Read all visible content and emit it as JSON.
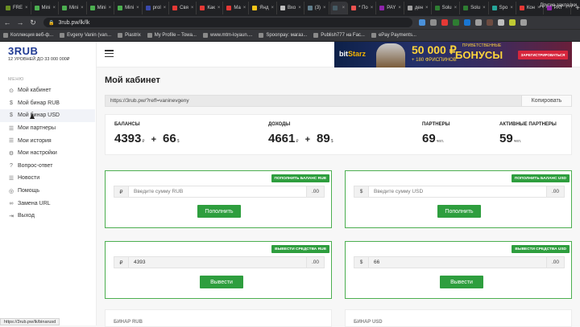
{
  "browser": {
    "tabs": [
      {
        "label": "FRE",
        "color": "#6b8e23"
      },
      {
        "label": "Mini",
        "color": "#4caf50"
      },
      {
        "label": "Mini",
        "color": "#4caf50"
      },
      {
        "label": "Mini",
        "color": "#4caf50"
      },
      {
        "label": "Mini",
        "color": "#4caf50"
      },
      {
        "label": "prol",
        "color": "#3949ab"
      },
      {
        "label": "Свя",
        "color": "#e53935"
      },
      {
        "label": "Как",
        "color": "#e53935"
      },
      {
        "label": "Ма",
        "color": "#e53935"
      },
      {
        "label": "Янд",
        "color": "#f5c518"
      },
      {
        "label": "Вхо",
        "color": "#bdbdbd"
      },
      {
        "label": "(3)",
        "color": "#607d8b"
      },
      {
        "label": "",
        "color": "#455a64"
      },
      {
        "label": "* По",
        "color": "#ef5350"
      },
      {
        "label": "PAY",
        "color": "#8e24aa"
      },
      {
        "label": "ден",
        "color": "#9e9e9e"
      },
      {
        "label": "Solu",
        "color": "#2e7d32"
      },
      {
        "label": "Solu",
        "color": "#2e7d32"
      },
      {
        "label": "Spo",
        "color": "#26a69a"
      },
      {
        "label": "Кон",
        "color": "#e53935"
      },
      {
        "label": "PAY",
        "color": "#8e24aa"
      }
    ],
    "url": "3rub.pw/lk/lk",
    "bookmarks": [
      "Коллекция веб-ф...",
      "Evgeny Vanin (van...",
      "Piastrix",
      "My Profile – Towa...",
      "www.mtm-loyaun....",
      "Spoonpay: магаз...",
      "Publish777 на Fac...",
      "ePay Payments..."
    ],
    "other_bookmarks": "Другие закладки",
    "status_url": "https://3rub.pw/lk/binarusd"
  },
  "sidebar": {
    "logo": "3RUB",
    "tagline": "12 УРОВНЕЙ ДО 33 000 000₽",
    "menu_heading": "МЕНЮ",
    "items": [
      {
        "label": "Мой кабинет",
        "icon": "user-icon",
        "glyph": "⊙"
      },
      {
        "label": "Мой бинар RUB",
        "icon": "dollar-icon",
        "glyph": "$"
      },
      {
        "label": "Мой бинар USD",
        "icon": "dollar-icon",
        "glyph": "$"
      },
      {
        "label": "Мои партнеры",
        "icon": "users-icon",
        "glyph": "☰"
      },
      {
        "label": "Мои история",
        "icon": "list-icon",
        "glyph": "☰"
      },
      {
        "label": "Мои настройки",
        "icon": "gear-icon",
        "glyph": "⚙"
      },
      {
        "label": "Вопрос-ответ",
        "icon": "question-icon",
        "glyph": "?"
      },
      {
        "label": "Новости",
        "icon": "news-icon",
        "glyph": "☰"
      },
      {
        "label": "Помощь",
        "icon": "help-icon",
        "glyph": "◎"
      },
      {
        "label": "Замена URL",
        "icon": "link-icon",
        "glyph": "∞"
      },
      {
        "label": "Выход",
        "icon": "logout-icon",
        "glyph": "⇥"
      }
    ]
  },
  "banner": {
    "brand": "bit",
    "brand_accent": "Starz",
    "amount": "50 000 ₽",
    "free_spins": "+ 180 ФРИСПИНОВ",
    "title_small": "ПРИВЕТСТВЕННЫЕ",
    "title_big": "БОНУСЫ",
    "button": "ЗАРЕГИСТРИРОВАТЬСЯ"
  },
  "page": {
    "title": "Мой кабинет",
    "ref_url": "https://3rub.pw/?reff=vaninevgeny",
    "copy_label": "Копировать"
  },
  "stats": {
    "balance_label": "БАЛАНСЫ",
    "balance_rub": "4393",
    "rub_sign": "₽",
    "plus": "+",
    "balance_usd": "66",
    "usd_sign": "$",
    "income_label": "ДОХОДЫ",
    "income_rub": "4661",
    "income_usd": "89",
    "partners_label": "ПАРТНЕРЫ",
    "partners_value": "69",
    "partners_unit": "чел.",
    "active_label": "АКТИВНЫЕ ПАРТНЕРЫ",
    "active_value": "59",
    "active_unit": "чел."
  },
  "cards": {
    "topup_rub": {
      "tag": "ПОПОЛНИТЬ БАЛАНС RUB",
      "currency": "₽",
      "placeholder": "Введите сумму RUB",
      "decimal": ".00",
      "button": "Пополнить"
    },
    "topup_usd": {
      "tag": "ПОПОЛНИТЬ БАЛАНС USD",
      "currency": "$",
      "placeholder": "Введите сумму USD",
      "decimal": ".00",
      "button": "Пополнить"
    },
    "withdraw_rub": {
      "tag": "ВЫВЕСТИ СРЕДСТВА RUB",
      "currency": "₽",
      "value": "4393",
      "decimal": ".00",
      "button": "Вывести"
    },
    "withdraw_usd": {
      "tag": "ВЫВЕСТИ СРЕДСТВА USD",
      "currency": "$",
      "value": "66",
      "decimal": ".00",
      "button": "Вывести"
    }
  },
  "bottom": {
    "left": "БИНАР RUB",
    "right": "БИНАР USD"
  }
}
